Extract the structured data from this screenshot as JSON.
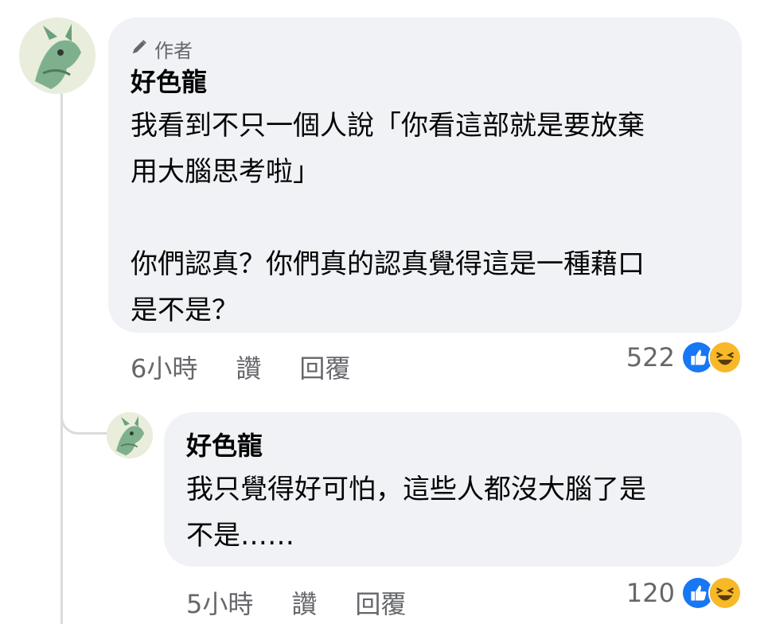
{
  "comment1": {
    "badge": "作者",
    "name": "好色龍",
    "lines": [
      "我看到不只一個人說「你看這部就是要放棄",
      "用大腦思考啦」",
      "",
      "你們認真？你們真的認真覺得這是一種藉口",
      "是不是？"
    ],
    "time": "6小時",
    "like_label": "讚",
    "reply_label": "回覆",
    "reactions": "522"
  },
  "comment2": {
    "name": "好色龍",
    "lines": [
      "我只覺得好可怕，這些人都沒大腦了是",
      "不是……"
    ],
    "time": "5小時",
    "like_label": "讚",
    "reply_label": "回覆",
    "reactions": "120"
  },
  "colors": {
    "bubble": "#f0f2f5",
    "meta_text": "#65676b",
    "like_blue": "#1877f2",
    "haha_yellow": "#f7b928"
  },
  "icons": [
    "pencil-icon",
    "like-icon",
    "haha-icon"
  ]
}
